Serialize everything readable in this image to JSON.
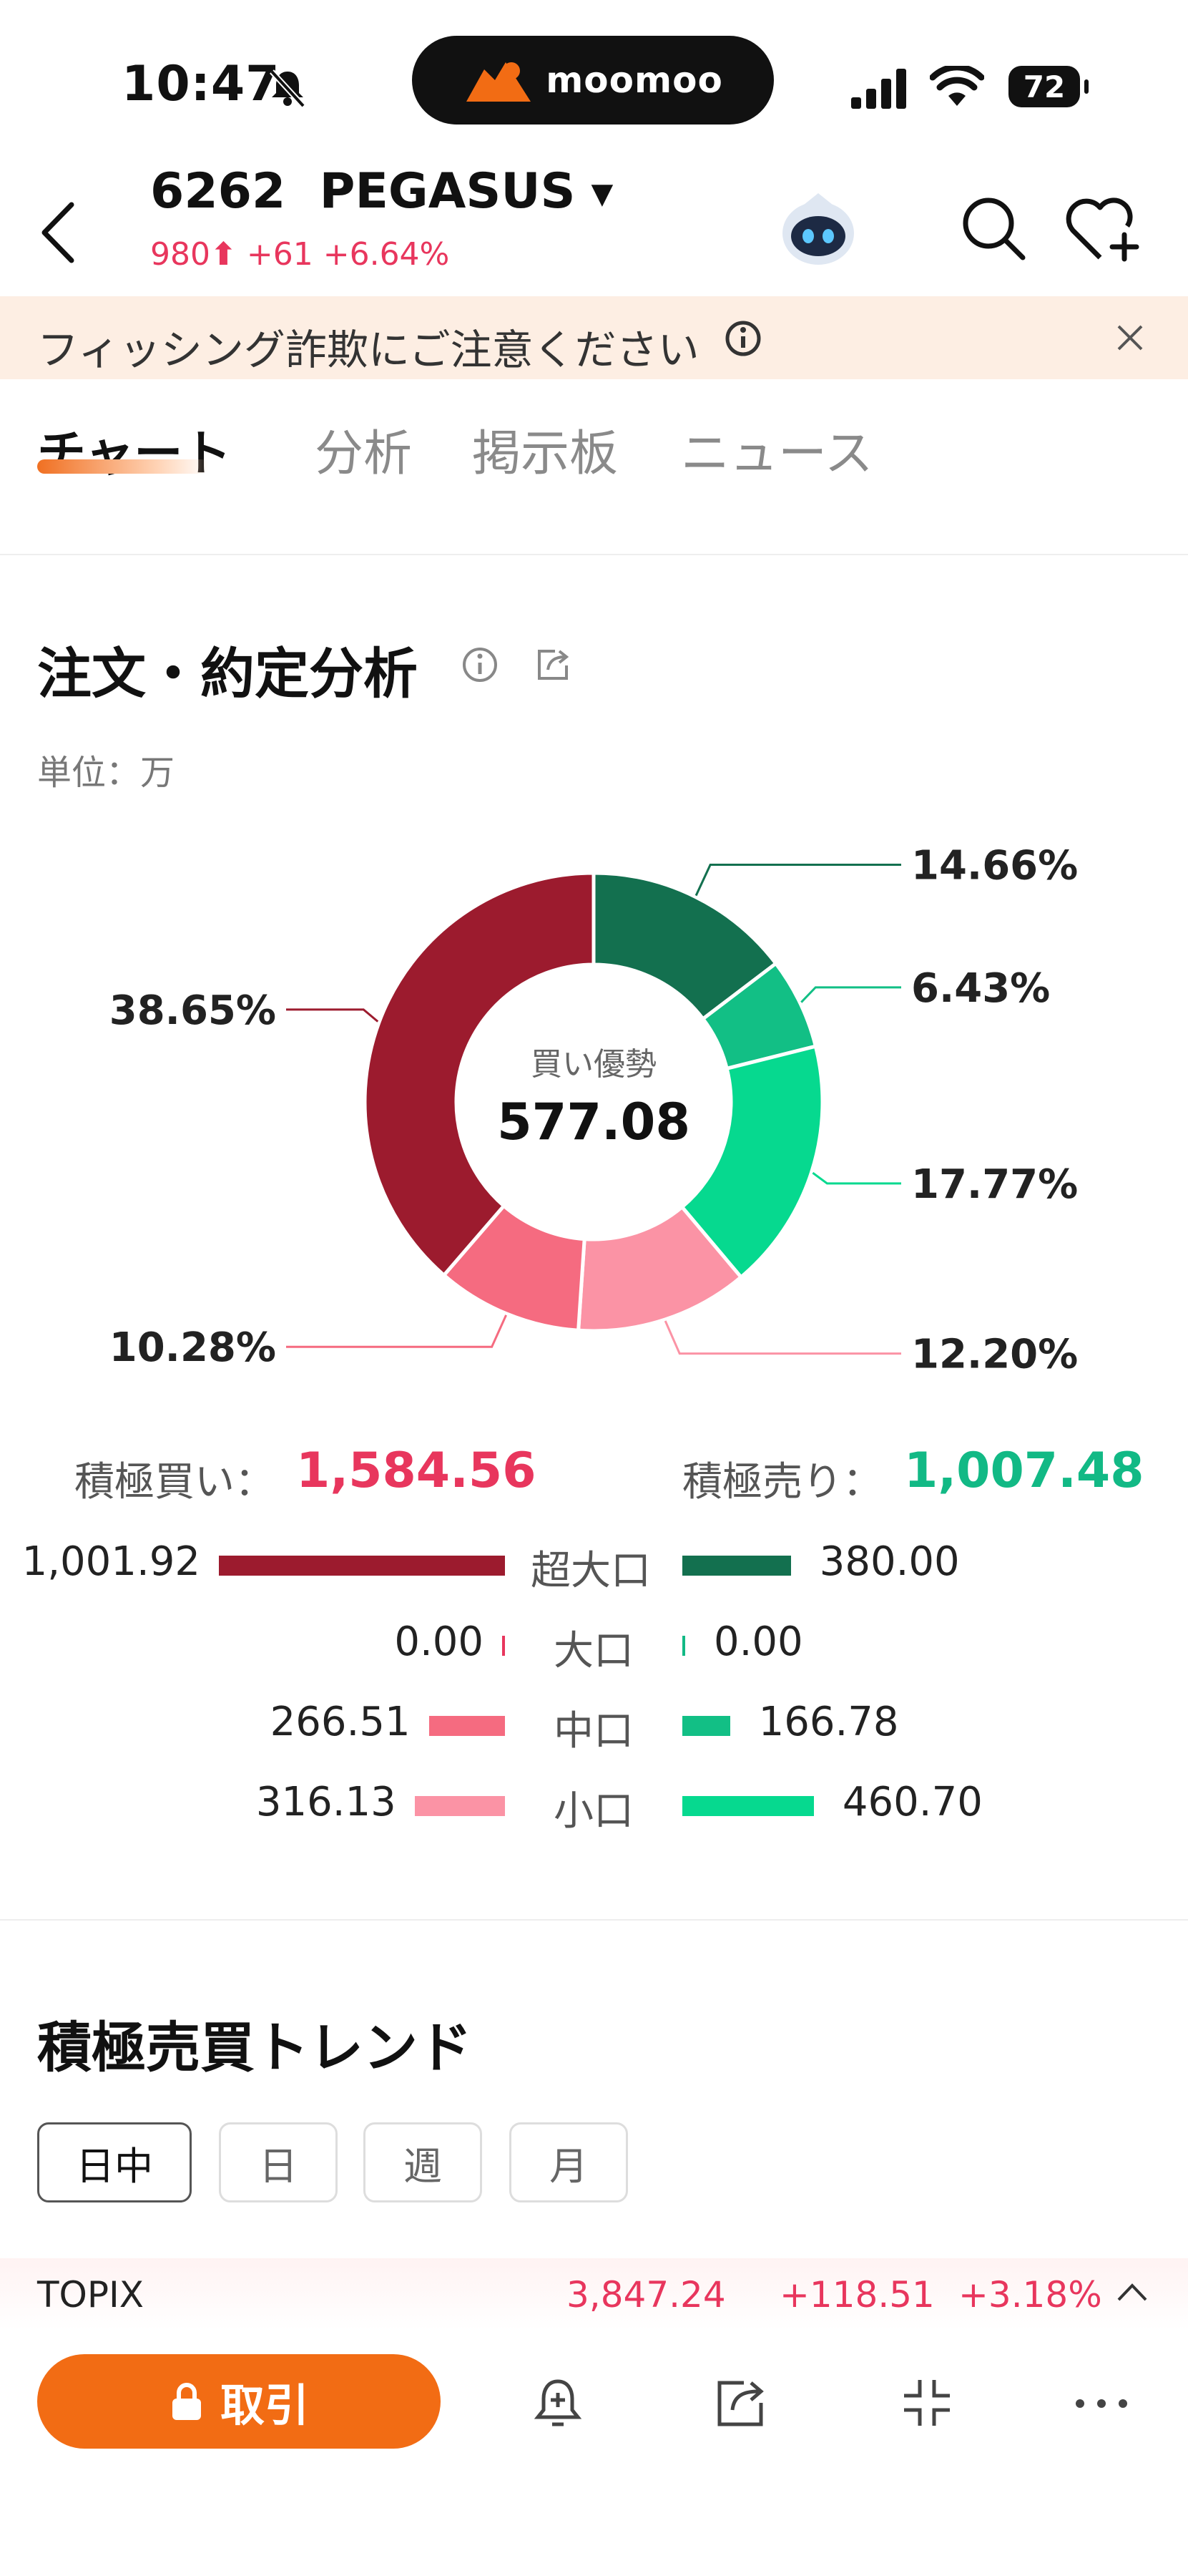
{
  "status_bar": {
    "time": "10:47",
    "battery": "72",
    "brand": "moomoo"
  },
  "header": {
    "code": "6262",
    "name": "PEGASUS",
    "price": "980",
    "change": "+61",
    "change_pct": "+6.64%"
  },
  "banner": {
    "text": "フィッシング詐欺にご注意ください"
  },
  "tabs": [
    "チャート",
    "分析",
    "掲示板",
    "ニュース"
  ],
  "analysis": {
    "title": "注文・約定分析",
    "unit": "単位：万",
    "center_label": "買い優勢",
    "center_value": "577.08"
  },
  "chart_data": {
    "type": "pie",
    "slices": [
      {
        "label": "超大口 売り",
        "value": 14.66,
        "display": "14.66%",
        "color": "#13704f"
      },
      {
        "label": "中口 売り",
        "value": 6.43,
        "display": "6.43%",
        "color": "#12bf85"
      },
      {
        "label": "小口 売り",
        "value": 17.77,
        "display": "17.77%",
        "color": "#06d98f"
      },
      {
        "label": "小口 買い",
        "value": 12.2,
        "display": "12.20%",
        "color": "#fb93a5"
      },
      {
        "label": "中口 買い",
        "value": 10.28,
        "display": "10.28%",
        "color": "#f56b80"
      },
      {
        "label": "超大口 買い",
        "value": 38.65,
        "display": "38.65%",
        "color": "#9c1b2e"
      }
    ]
  },
  "summary": {
    "buy_label": "積極買い：",
    "buy_value": "1,584.56",
    "sell_label": "積極売り：",
    "sell_value": "1,007.48"
  },
  "rows": [
    {
      "category": "超大口",
      "buy": "1,001.92",
      "sell": "380.00"
    },
    {
      "category": "大口",
      "buy": "0.00",
      "sell": "0.00"
    },
    {
      "category": "中口",
      "buy": "266.51",
      "sell": "166.78"
    },
    {
      "category": "小口",
      "buy": "316.13",
      "sell": "460.70"
    }
  ],
  "trend": {
    "title": "積極売買トレンド",
    "segments": [
      "日中",
      "日",
      "週",
      "月"
    ]
  },
  "topix": {
    "name": "TOPIX",
    "value": "3,847.24",
    "change": "+118.51",
    "pct": "+3.18%"
  },
  "bottom": {
    "trade_label": "取引"
  },
  "colors": {
    "accent": "#f26c14",
    "buy": "#e8365d",
    "sell": "#12b985"
  }
}
